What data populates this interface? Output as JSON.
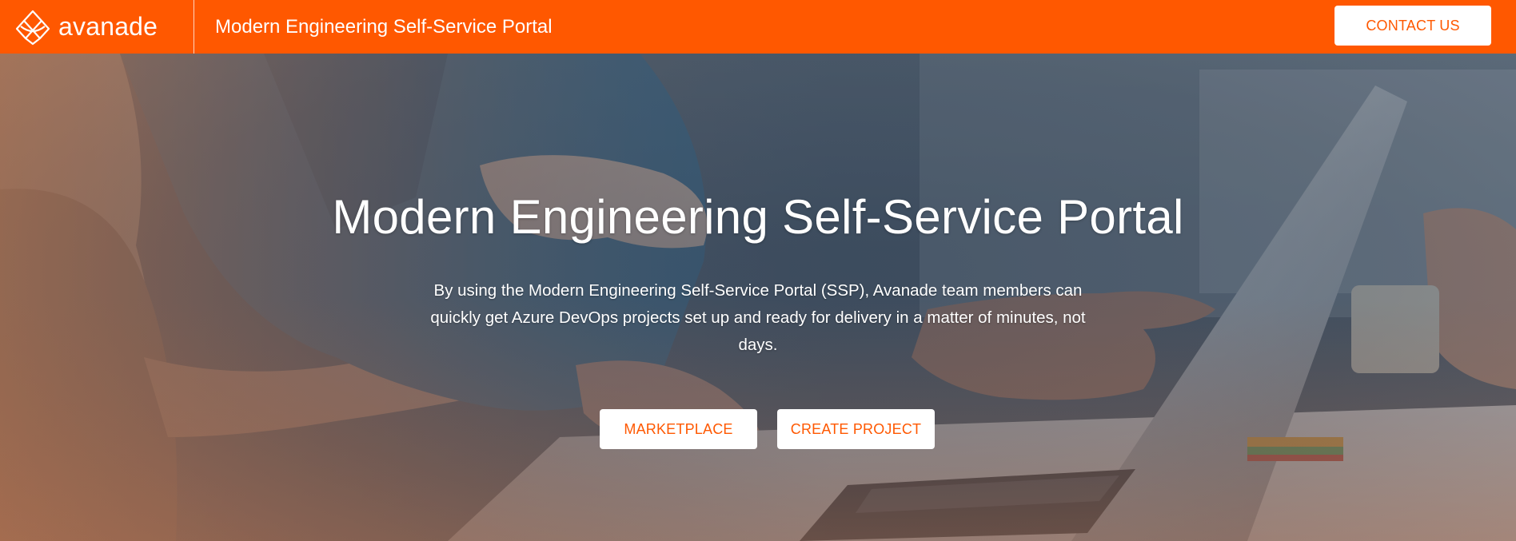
{
  "header": {
    "brand_name": "avanade",
    "title": "Modern Engineering Self-Service Portal",
    "contact_label": "CONTACT US",
    "brand_color": "#ff5800"
  },
  "hero": {
    "title": "Modern Engineering Self-Service Portal",
    "description": "By using the Modern Engineering Self-Service Portal (SSP), Avanade team members can quickly get Azure DevOps projects set up and ready for delivery in a matter of minutes, not days.",
    "buttons": {
      "marketplace_label": "MARKETPLACE",
      "create_project_label": "CREATE PROJECT"
    },
    "background_image": "office-team-laptop-photo"
  },
  "icons": {
    "logo": "avanade-logo-icon"
  }
}
